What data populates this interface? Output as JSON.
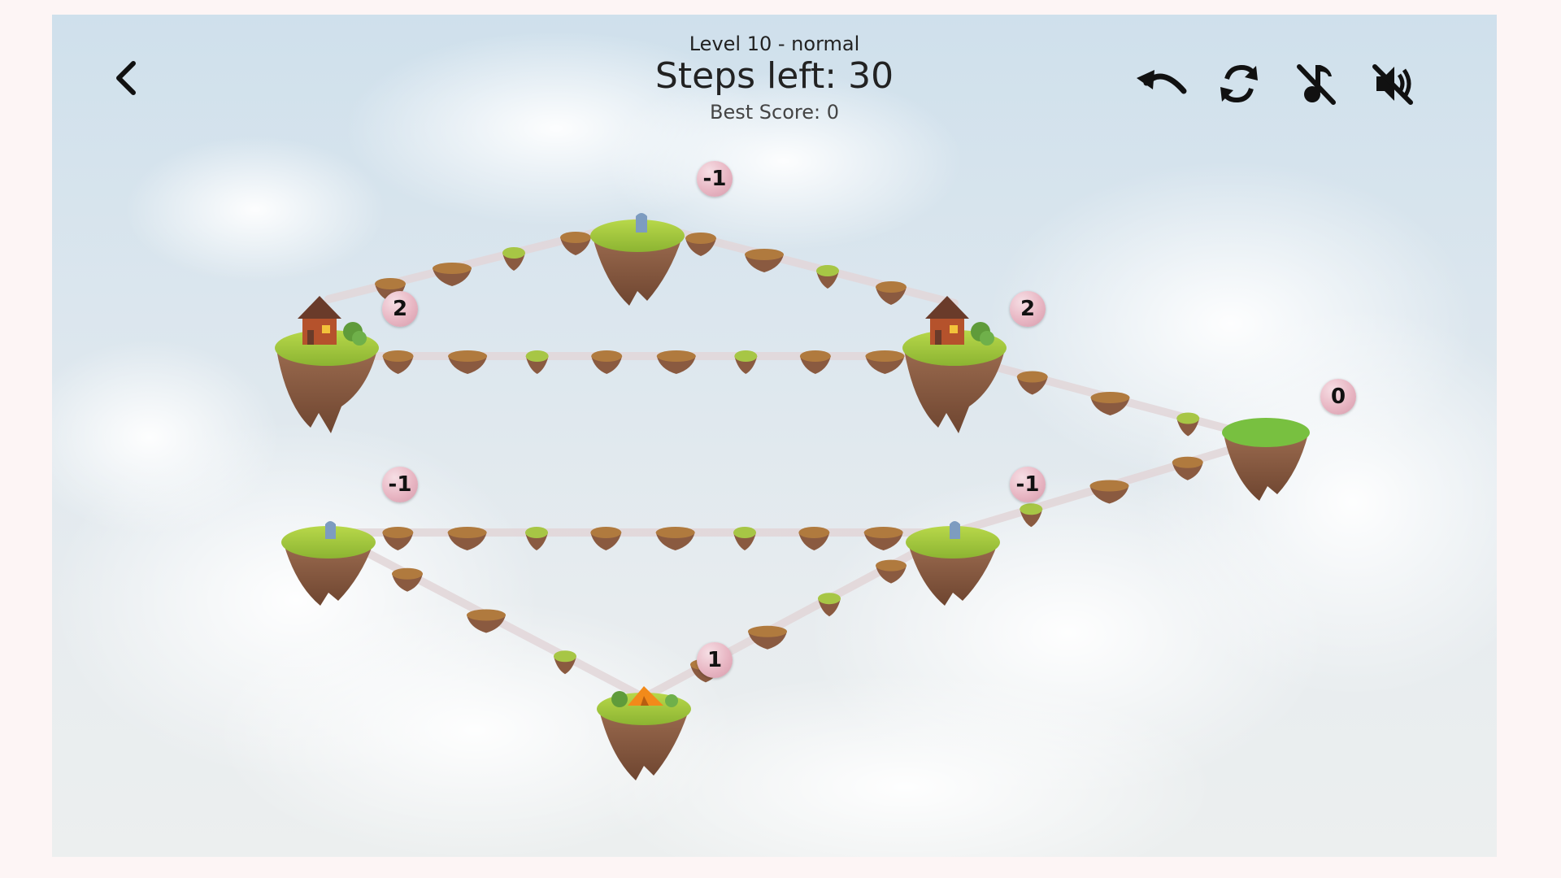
{
  "header": {
    "level_label": "Level 10 - normal",
    "steps_label": "Steps left: 30",
    "best_score_label": "Best Score: 0"
  },
  "toolbar": {
    "back_icon": "chevron-left-icon",
    "undo_icon": "undo-icon",
    "restart_icon": "refresh-icon",
    "music_icon": "music-off-icon",
    "sound_icon": "sound-off-icon"
  },
  "islands": [
    {
      "kind": "house"
    },
    {
      "kind": "stone"
    },
    {
      "kind": "house"
    },
    {
      "kind": "grass"
    },
    {
      "kind": "stone"
    },
    {
      "kind": "stone"
    },
    {
      "kind": "tent"
    }
  ],
  "badges": [
    "2",
    "-1",
    "2",
    "0",
    "-1",
    "-1",
    "1"
  ],
  "colors": {
    "badge": "#e8b6c3",
    "grass": "#9cc43a",
    "rock": "#8a5a40",
    "path": "#e2d6d8"
  }
}
